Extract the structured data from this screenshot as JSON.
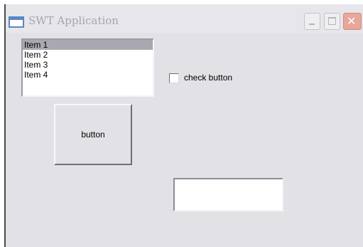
{
  "window": {
    "title": "SWT Application"
  },
  "list": {
    "items": [
      "Item 1",
      "Item 2",
      "Item 3",
      "Item 4"
    ],
    "selected_index": 0
  },
  "checkbox": {
    "label": "check button",
    "checked": false
  },
  "button": {
    "label": "button"
  },
  "textfield": {
    "value": ""
  },
  "colors": {
    "window_background": "#e2e1e6",
    "selected_item": "#a8a8b1",
    "close_button": "#e7a79b"
  },
  "icons": [
    "app-window-icon",
    "minimize-icon",
    "maximize-icon",
    "close-icon"
  ]
}
